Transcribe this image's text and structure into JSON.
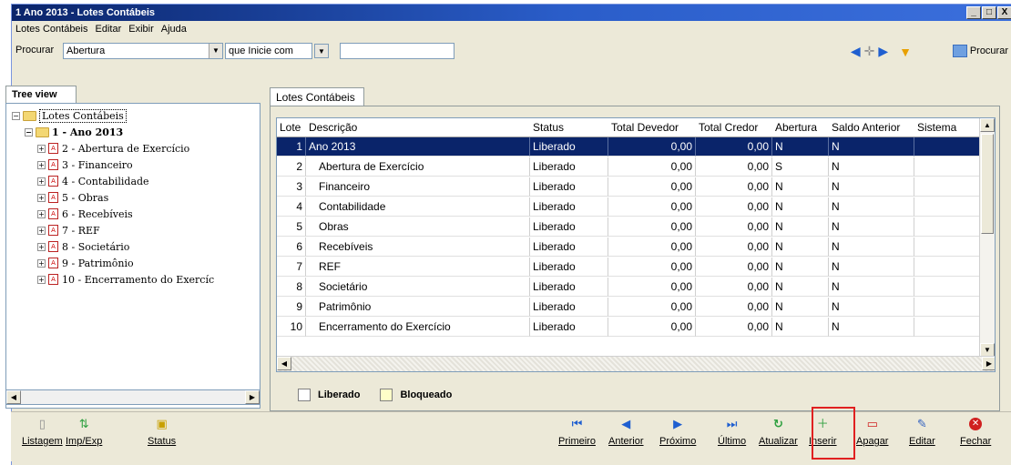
{
  "window": {
    "title": "1 Ano 2013 -  Lotes Contábeis",
    "buttons": [
      "_",
      "□",
      "X"
    ]
  },
  "menu": [
    "Lotes Contábeis",
    "Editar",
    "Exibir",
    "Ajuda"
  ],
  "search": {
    "label": "Procurar",
    "field_value": "Abertura",
    "mode_value": "que Inicie com",
    "text_value": "",
    "search_button_label": "Procurar"
  },
  "tree": {
    "tab_label": "Tree view",
    "root": "Lotes Contábeis",
    "year": "1 - Ano 2013",
    "items": [
      "2 - Abertura de Exercício",
      "3 - Financeiro",
      "4 - Contabilidade",
      "5 - Obras",
      "6 - Recebíveis",
      "7 - REF",
      "8 - Societário",
      "9 - Patrimônio",
      "10 - Encerramento do Exercíc"
    ]
  },
  "grid": {
    "tab_label": "Lotes Contábeis",
    "columns": [
      "Lote",
      "Descrição",
      "Status",
      "Total Devedor",
      "Total Credor",
      "Abertura",
      "Saldo Anterior",
      "Sistema"
    ],
    "rows": [
      [
        "1",
        "Ano 2013",
        "Liberado",
        "0,00",
        "0,00",
        "N",
        "N",
        ""
      ],
      [
        "2",
        "Abertura de Exercício",
        "Liberado",
        "0,00",
        "0,00",
        "S",
        "N",
        ""
      ],
      [
        "3",
        "Financeiro",
        "Liberado",
        "0,00",
        "0,00",
        "N",
        "N",
        ""
      ],
      [
        "4",
        "Contabilidade",
        "Liberado",
        "0,00",
        "0,00",
        "N",
        "N",
        ""
      ],
      [
        "5",
        "Obras",
        "Liberado",
        "0,00",
        "0,00",
        "N",
        "N",
        ""
      ],
      [
        "6",
        "Recebíveis",
        "Liberado",
        "0,00",
        "0,00",
        "N",
        "N",
        ""
      ],
      [
        "7",
        "REF",
        "Liberado",
        "0,00",
        "0,00",
        "N",
        "N",
        ""
      ],
      [
        "8",
        "Societário",
        "Liberado",
        "0,00",
        "0,00",
        "N",
        "N",
        ""
      ],
      [
        "9",
        "Patrimônio",
        "Liberado",
        "0,00",
        "0,00",
        "N",
        "N",
        ""
      ],
      [
        "10",
        "Encerramento do Exercício",
        "Liberado",
        "0,00",
        "0,00",
        "N",
        "N",
        ""
      ]
    ],
    "selected_row": 0
  },
  "legend": {
    "liberado": "Liberado",
    "bloqueado": "Bloqueado",
    "liberado_color": "#ffffff",
    "bloqueado_color": "#ffffc8"
  },
  "toolbar": {
    "left": [
      {
        "label": "Listagem",
        "icon": "document-icon"
      },
      {
        "label": "Imp/Exp",
        "icon": "import-export-icon"
      },
      {
        "label": "Status",
        "icon": "lock-icon"
      }
    ],
    "right": [
      {
        "label": "Primeiro",
        "icon": "first-icon"
      },
      {
        "label": "Anterior",
        "icon": "previous-icon"
      },
      {
        "label": "Próximo",
        "icon": "next-icon"
      },
      {
        "label": "Último",
        "icon": "last-icon"
      },
      {
        "label": "Atualizar",
        "icon": "refresh-icon"
      },
      {
        "label": "Inserir",
        "icon": "insert-icon"
      },
      {
        "label": "Apagar",
        "icon": "delete-icon"
      },
      {
        "label": "Editar",
        "icon": "edit-icon"
      },
      {
        "label": "Fechar",
        "icon": "close-icon"
      }
    ]
  },
  "colors": {
    "selection": "#0a246a",
    "titlebar": "#0a246a",
    "highlight": "#e02020",
    "nav_arrow": "#1f5fd0",
    "refresh": "#2fa040",
    "close": "#d02020"
  }
}
